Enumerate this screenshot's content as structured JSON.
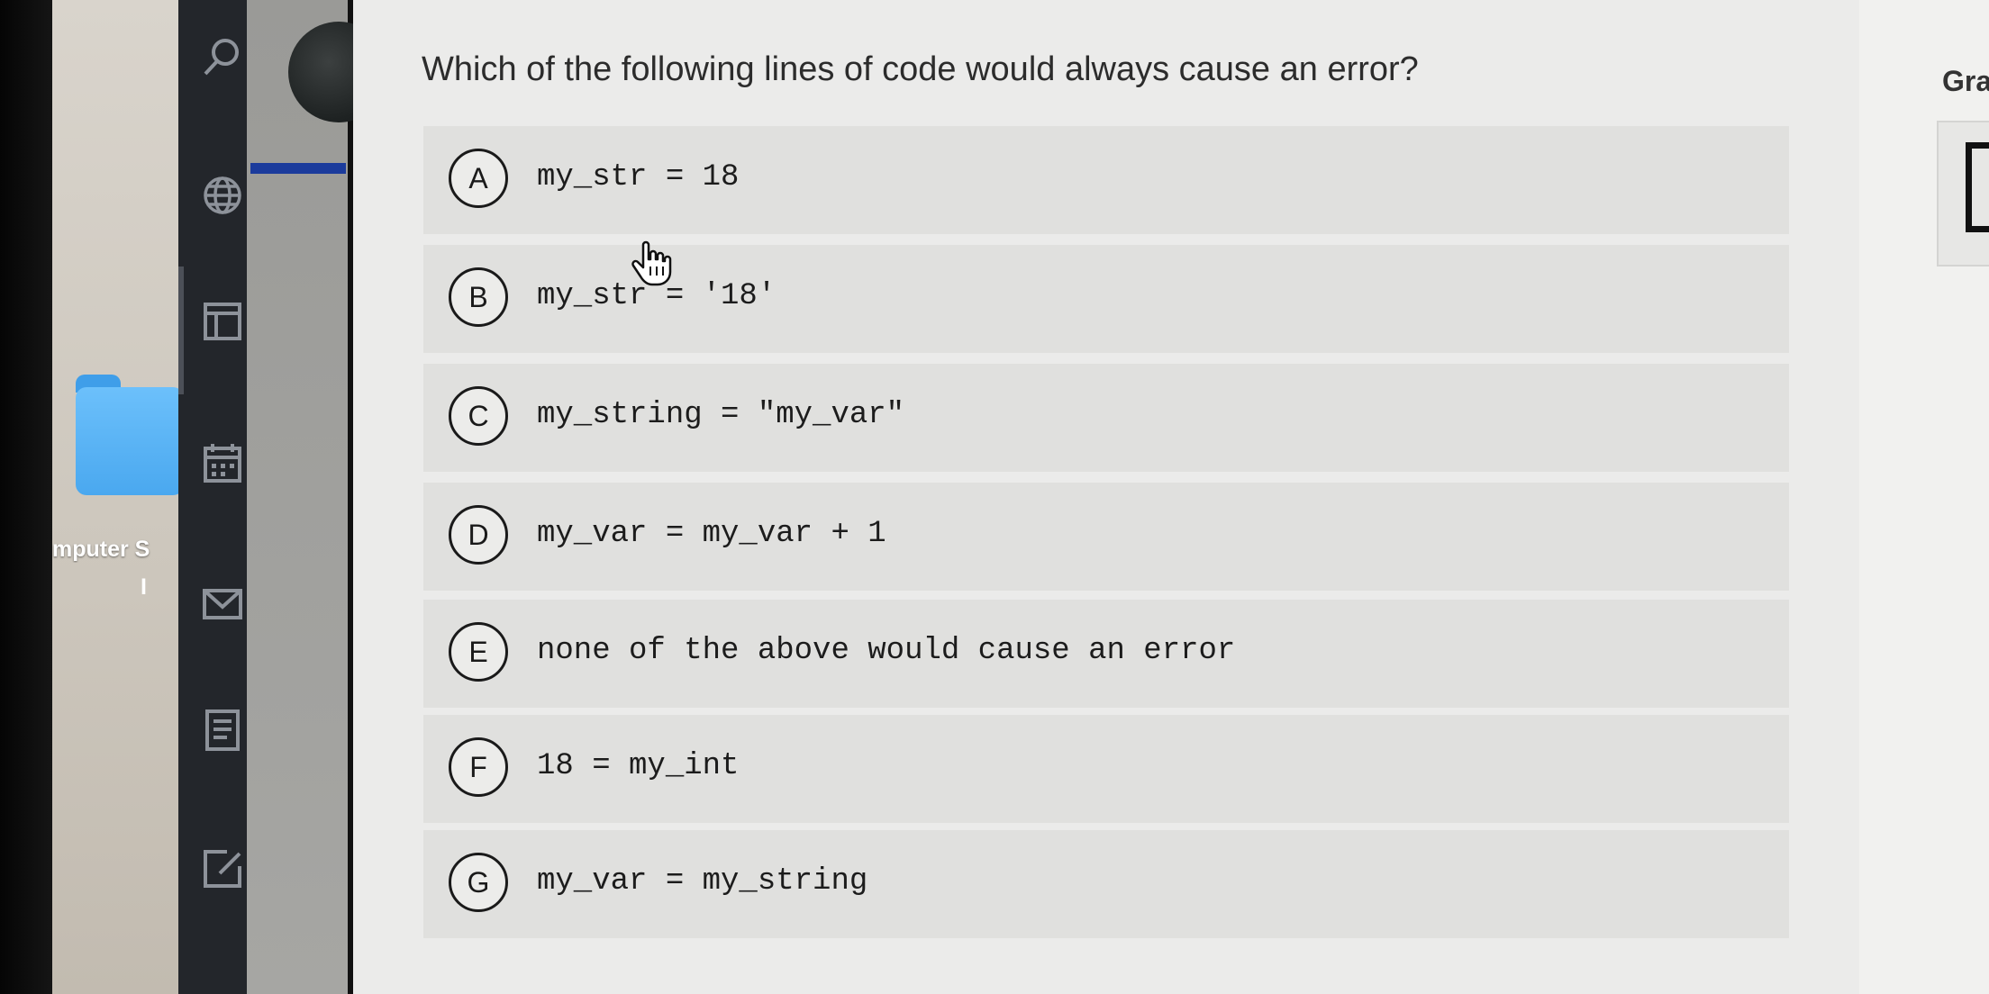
{
  "desktop": {
    "folder_label": "mputer S",
    "folder_label_2": "I"
  },
  "question": {
    "text": "Which of the following lines of code would always cause an error?"
  },
  "options": [
    {
      "letter": "A",
      "code": "my_str = 18"
    },
    {
      "letter": "B",
      "code": "my_str = '18'"
    },
    {
      "letter": "C",
      "code": "my_string = \"my_var\""
    },
    {
      "letter": "D",
      "code": "my_var = my_var + 1"
    },
    {
      "letter": "E",
      "code": "none of the above would cause an error"
    },
    {
      "letter": "F",
      "code": "18 = my_int"
    },
    {
      "letter": "G",
      "code": "my_var = my_string"
    }
  ],
  "right_panel": {
    "title": "Gra"
  },
  "colors": {
    "sidebar": "#23262b",
    "accent": "#1b3b9c",
    "folder": "#4aa8ef",
    "content_bg": "#ebebea",
    "option_bg": "#e0e0de"
  },
  "icons": [
    "search-icon",
    "globe-icon",
    "layout-icon",
    "calendar-icon",
    "mail-icon",
    "document-list-icon",
    "edit-icon",
    "hand-pointer-icon"
  ]
}
